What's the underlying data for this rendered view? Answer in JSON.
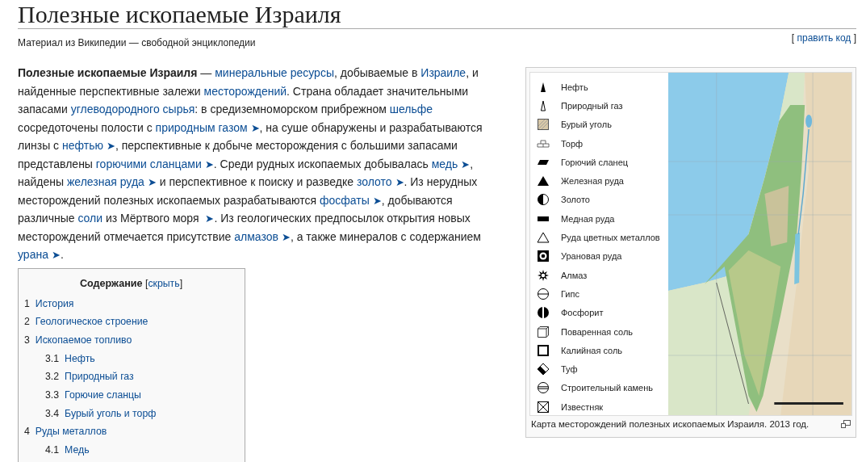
{
  "title": "Полезные ископаемые Израиля",
  "subtitle": "Материал из Википедии — свободной энциклопедии",
  "edit_parts": [
    "[ ",
    "править код",
    " ]"
  ],
  "intro": [
    {
      "kind": "bold",
      "text": "Полезные ископаемые Израиля"
    },
    {
      "kind": "text",
      "text": " — "
    },
    {
      "kind": "link",
      "text": "минеральные ресурсы"
    },
    {
      "kind": "text",
      "text": ", добываемые в "
    },
    {
      "kind": "link",
      "text": "Израиле"
    },
    {
      "kind": "text",
      "text": ", и найденные перспективные залежи "
    },
    {
      "kind": "link",
      "text": "месторождений"
    },
    {
      "kind": "text",
      "text": ". Страна обладает значительными запасами "
    },
    {
      "kind": "link",
      "text": "углеводородного сырья"
    },
    {
      "kind": "text",
      "text": ": в средиземноморском прибрежном "
    },
    {
      "kind": "link",
      "text": "шельфе"
    },
    {
      "kind": "text",
      "text": " сосредоточены полости с "
    },
    {
      "kind": "link",
      "text": "природным газом"
    },
    {
      "kind": "arrow",
      "text": "➤"
    },
    {
      "kind": "text",
      "text": ", на суше обнаружены и разрабатываются линзы с "
    },
    {
      "kind": "link",
      "text": "нефтью"
    },
    {
      "kind": "arrow",
      "text": "➤"
    },
    {
      "kind": "text",
      "text": ", перспективные к добыче месторождения с большими запасами представлены "
    },
    {
      "kind": "link",
      "text": "горючими сланцами"
    },
    {
      "kind": "arrow",
      "text": "➤"
    },
    {
      "kind": "text",
      "text": ". Среди рудных ископаемых добывалась "
    },
    {
      "kind": "link",
      "text": "медь"
    },
    {
      "kind": "arrow",
      "text": "➤"
    },
    {
      "kind": "text",
      "text": ", найдены "
    },
    {
      "kind": "link",
      "text": "железная руда"
    },
    {
      "kind": "arrow",
      "text": "➤"
    },
    {
      "kind": "text",
      "text": " и перспективное к поиску и разведке "
    },
    {
      "kind": "link",
      "text": "золото"
    },
    {
      "kind": "arrow",
      "text": "➤"
    },
    {
      "kind": "text",
      "text": ". Из нерудных месторождений полезных ископаемых разрабатываются "
    },
    {
      "kind": "link",
      "text": "фосфаты"
    },
    {
      "kind": "arrow",
      "text": "➤"
    },
    {
      "kind": "text",
      "text": ", добываются различные "
    },
    {
      "kind": "link",
      "text": "соли"
    },
    {
      "kind": "text",
      "text": " из Мёртвого моря "
    },
    {
      "kind": "arrow",
      "text": "➤"
    },
    {
      "kind": "text",
      "text": ". Из геологических предпосылок открытия новых месторождений отмечается присутствие "
    },
    {
      "kind": "link",
      "text": "алмазов"
    },
    {
      "kind": "arrow",
      "text": "➤"
    },
    {
      "kind": "text",
      "text": ", а также минералов с содержанием "
    },
    {
      "kind": "link",
      "text": "урана"
    },
    {
      "kind": "arrow",
      "text": "➤"
    },
    {
      "kind": "text",
      "text": "."
    }
  ],
  "toc": {
    "title": "Содержание",
    "toggle_parts": [
      "[",
      "скрыть",
      "]"
    ],
    "items": [
      {
        "number": "1",
        "label": "История"
      },
      {
        "number": "2",
        "label": "Геологическое строение"
      },
      {
        "number": "3",
        "label": "Ископаемое топливо",
        "children": [
          {
            "number": "3.1",
            "label": "Нефть"
          },
          {
            "number": "3.2",
            "label": "Природный газ"
          },
          {
            "number": "3.3",
            "label": "Горючие сланцы"
          },
          {
            "number": "3.4",
            "label": "Бурый уголь и торф"
          }
        ]
      },
      {
        "number": "4",
        "label": "Руды металлов",
        "children": [
          {
            "number": "4.1",
            "label": "Медь"
          }
        ]
      }
    ]
  },
  "figure": {
    "kind": "picture",
    "caption": "Карта месторождений полезных ископаемых Израиля. 2013 год.",
    "legend": [
      {
        "kind": "oil",
        "label": "Нефть"
      },
      {
        "kind": "gas",
        "label": "Природный газ"
      },
      {
        "kind": "lignite",
        "label": "Бурый уголь"
      },
      {
        "kind": "peat",
        "label": "Торф"
      },
      {
        "kind": "shale",
        "label": "Горючий сланец"
      },
      {
        "kind": "iron",
        "label": "Железная руда"
      },
      {
        "kind": "gold",
        "label": "Золото"
      },
      {
        "kind": "copper",
        "label": "Медная руда"
      },
      {
        "kind": "nonferrous",
        "label": "Руда цветных металлов"
      },
      {
        "kind": "uranium",
        "label": "Урановая руда"
      },
      {
        "kind": "diamond",
        "label": "Алмаз"
      },
      {
        "kind": "gypsum",
        "label": "Гипс"
      },
      {
        "kind": "phosphorite",
        "label": "Фосфорит"
      },
      {
        "kind": "salt",
        "label": "Поваренная соль"
      },
      {
        "kind": "potash",
        "label": "Калийная соль"
      },
      {
        "kind": "tuff",
        "label": "Туф"
      },
      {
        "kind": "stone",
        "label": "Строительный камень"
      },
      {
        "kind": "limestone",
        "label": "Известняк"
      }
    ]
  }
}
